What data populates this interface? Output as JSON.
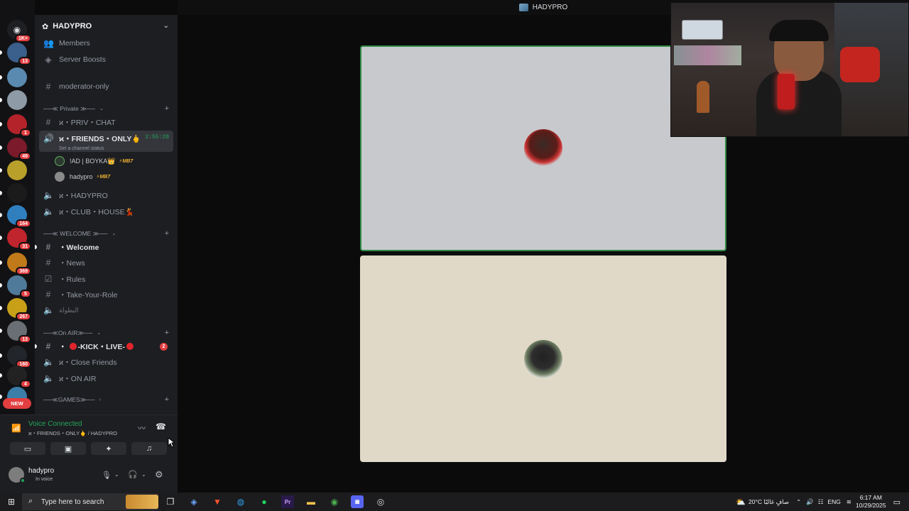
{
  "window": {
    "title": "HADYPRO"
  },
  "rail": {
    "top_badge": "1K+",
    "servers": [
      {
        "badge": "13",
        "color": "#3a5f8a"
      },
      {
        "badge": "",
        "color": "#5a8ab0"
      },
      {
        "badge": "",
        "color": "#8e9aa6"
      },
      {
        "badge": "1",
        "color": "#b4232a"
      },
      {
        "badge": "49",
        "color": "#7a1a2a"
      },
      {
        "badge": "",
        "color": "#b9a02a"
      },
      {
        "badge": "",
        "color": "#1b1b1b"
      },
      {
        "badge": "164",
        "color": "#2f7fbf"
      },
      {
        "badge": "31",
        "color": "#c0242c"
      },
      {
        "badge": "369",
        "color": "#c07a1a"
      },
      {
        "badge": "5",
        "color": "#4f7a9a"
      },
      {
        "badge": "267",
        "color": "#c7a018"
      },
      {
        "badge": "13",
        "color": "#6a6f75"
      },
      {
        "badge": "160",
        "color": "#22262b"
      },
      {
        "badge": "4",
        "color": "#222"
      },
      {
        "badge": "",
        "color": "#3b7fa8"
      }
    ],
    "new_label": "NEW"
  },
  "sidebar": {
    "server_name": "HADYPRO",
    "top_items": [
      "Members",
      "Server Boosts"
    ],
    "moderator": "moderator-only",
    "cat_private": "──≪ Private ≫──",
    "private_channels": [
      "ϰ・PRIV・CHAT"
    ],
    "active_channel": {
      "name": "ϰ・FRIENDS・ONLY🖕",
      "timer": "2:55:28",
      "status": "Set a channel status"
    },
    "members": [
      {
        "name": "!AD | BOYKA👑",
        "tag": "⚡MB7"
      },
      {
        "name": "hadypro",
        "tag": "⚡MB7"
      }
    ],
    "voice_after": [
      "ϰ・HADYPRO",
      "ϰ・CLUB・HOUSE💃"
    ],
    "cat_welcome": "──≪ WELCOME ≫──",
    "welcome_channels": [
      {
        "icon": "#",
        "name": "・Welcome",
        "bright": true
      },
      {
        "icon": "#",
        "name": "・News",
        "bright": false
      },
      {
        "icon": "☑",
        "name": "・Rules",
        "bright": false
      },
      {
        "icon": "#",
        "name": "・Take-Your-Role",
        "bright": false
      },
      {
        "icon": "🔈",
        "name": "البطولة",
        "bright": false
      }
    ],
    "cat_onair": "──≪On AIR≫──",
    "kick_channel": {
      "name": "-KICK・LIVE-",
      "mentions": "2"
    },
    "onair_voice": [
      "ϰ・Close Friends",
      "ϰ・ON AIR"
    ],
    "cat_games": "──≪GAMES≫──"
  },
  "voice": {
    "status": "Voice Connected",
    "channel": "ϰ・FRIENDS・ONLY🖕 / HADYPRO",
    "user": "hadypro",
    "user_status": "In voice"
  },
  "taskbar": {
    "search_placeholder": "Type here to search",
    "weather": "20°C صافٍ غالبًا",
    "lang": "ENG",
    "time": "6:17 AM",
    "date": "10/29/2025"
  },
  "colors": {
    "accent_green": "#2e8a45",
    "badge_red": "#e33e40",
    "connected_green": "#23a559"
  }
}
